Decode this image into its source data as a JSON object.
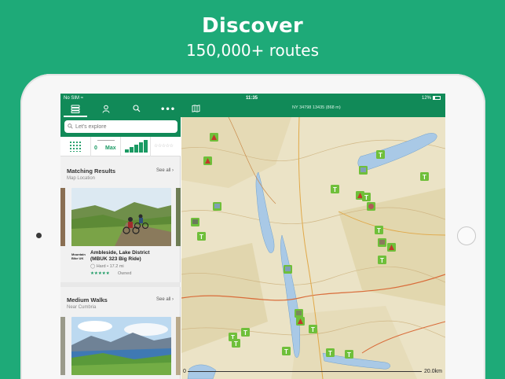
{
  "hero": {
    "title": "Discover",
    "subtitle": "150,000+ routes"
  },
  "status_bar": {
    "carrier": "No SIM",
    "time": "11:35",
    "battery": "12%"
  },
  "toolbar": {
    "grid_reference": "NY 34798 13435 (868 m)",
    "icons": [
      "routes-icon",
      "profile-icon",
      "search-icon",
      "more-icon",
      "map-icon"
    ]
  },
  "search": {
    "placeholder": "Let's explore"
  },
  "filters": {
    "distance_label": "Distance",
    "distance_min": "0",
    "distance_max": "Max",
    "rating_label": "Rating"
  },
  "matching": {
    "title": "Matching Results",
    "subtitle": "Map Location",
    "see_all": "See all ›",
    "route": {
      "logo_text": "Mountain Bike UK",
      "name_line1": "Ambleside, Lake District",
      "name_line2": "(MBUK 323 Big Ride)",
      "difficulty": "Hard",
      "distance": "17.2 mi",
      "stars": "★★★★★",
      "status": "Owned"
    }
  },
  "medium_walks": {
    "title": "Medium Walks",
    "subtitle": "Near Cumbria",
    "see_all": "See all ›"
  },
  "map": {
    "scale_start": "0",
    "scale_end": "20.0km"
  },
  "colors": {
    "background": "#1eaa78",
    "app_green": "#118a58",
    "accent": "#1a9a63",
    "map_base": "#e9e0c2",
    "water": "#a9c9e6"
  }
}
